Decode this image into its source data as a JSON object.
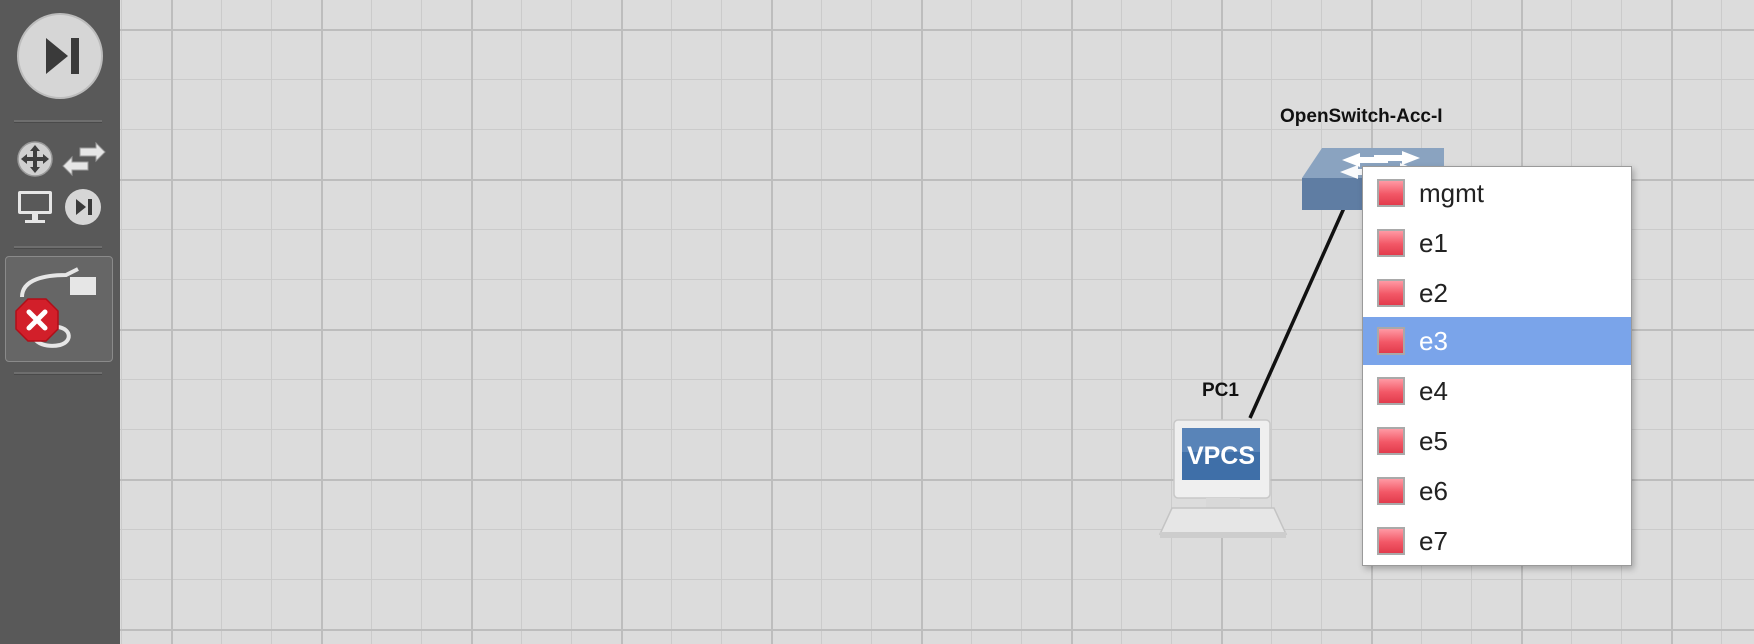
{
  "toolbar": {
    "run_button_icon": "play-pause-icon",
    "small_tools": [
      "router-icon",
      "switch-arrows-icon",
      "pc-icon",
      "play-pause-small-icon"
    ],
    "link_tool": {
      "icon": "cable-link-icon",
      "state": "cancel",
      "state_icon": "red-x-icon"
    }
  },
  "topology": {
    "nodes": [
      {
        "id": "switch",
        "label": "OpenSwitch-Acc-I",
        "icon": "network-switch-icon"
      },
      {
        "id": "pc",
        "label": "PC1",
        "icon": "vpcs-pc-icon",
        "screen_text": "VPCS"
      }
    ],
    "links": [
      {
        "from": "PC1",
        "to": "OpenSwitch-Acc-I"
      }
    ]
  },
  "port_menu": {
    "selected": "e3",
    "items": [
      {
        "label": "mgmt",
        "status_color": "#f25766"
      },
      {
        "label": "e1",
        "status_color": "#f25766"
      },
      {
        "label": "e2",
        "status_color": "#f25766"
      },
      {
        "label": "e3",
        "status_color": "#f25766"
      },
      {
        "label": "e4",
        "status_color": "#f25766"
      },
      {
        "label": "e5",
        "status_color": "#f25766"
      },
      {
        "label": "e6",
        "status_color": "#f25766"
      },
      {
        "label": "e7",
        "status_color": "#f25766"
      }
    ],
    "highlight_color": "#7aa4ea"
  }
}
